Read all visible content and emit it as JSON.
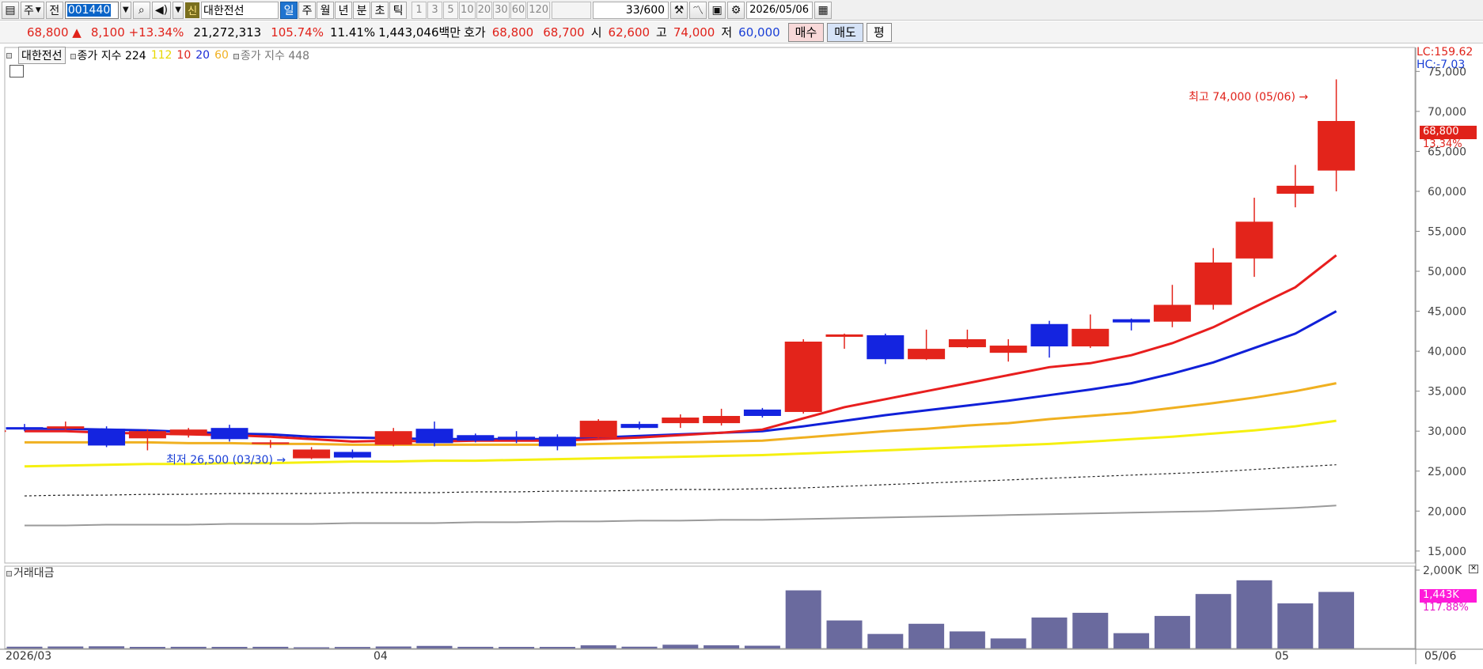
{
  "toolbar": {
    "period_label": "주",
    "prev_label": "전",
    "code": "001440",
    "xin_badge": "신",
    "stock_name": "대한전선",
    "periods": [
      "일",
      "주",
      "월",
      "년",
      "분",
      "초",
      "틱"
    ],
    "active_period": "일",
    "intervals": [
      "1",
      "3",
      "5",
      "10",
      "20",
      "30",
      "60",
      "120"
    ],
    "count": "33/600",
    "date": "2026/05/06"
  },
  "quote": {
    "price": "68,800",
    "direction": "▲",
    "change": "8,100",
    "change_pct": "+13.34%",
    "volume": "21,272,313",
    "volume_ratio": "105.74%",
    "turnover": "11.41%",
    "amount": "1,443,046백만",
    "bid_label": "호가",
    "ask": "68,800",
    "bid": "68,700",
    "open_label": "시",
    "open": "62,600",
    "high_label": "고",
    "high": "74,000",
    "low_label": "저",
    "low": "60,000",
    "buy_label": "매수",
    "sell_label": "매도",
    "flat_label": "평"
  },
  "legend": {
    "stock": "대한전선",
    "index_label": "종가 지수 224",
    "ma_112": "112",
    "ma_10": "10",
    "ma_20": "20",
    "ma_60": "60",
    "index2_label": "종가 지수 448",
    "volume_label": "거래대금"
  },
  "axis_info": {
    "lc": "LC:159.62",
    "hc": "HC:-7.03",
    "price_tag": "68,800",
    "pct_tag": "13.34%",
    "vol_tag": "1,443K",
    "vol_pct_tag": "117.88%"
  },
  "annotations": {
    "high": "최고 74,000 (05/06)",
    "low": "최저 26,500 (03/30)"
  },
  "date_labels": {
    "start": "2026/03",
    "apr": "04",
    "may": "05",
    "end": "05/06"
  },
  "colors": {
    "up": "#e3241b",
    "down": "#1424e0",
    "ma10": "#e81e1e",
    "ma20": "#1020d8",
    "ma60": "#f0b020",
    "ma112": "#f5f010",
    "volume": "#6a6a9e"
  },
  "chart_data": {
    "type": "candlestick",
    "price_axis": {
      "ticks": [
        "15,000",
        "20,000",
        "25,000",
        "30,000",
        "35,000",
        "40,000",
        "45,000",
        "50,000",
        "55,000",
        "60,000",
        "65,000",
        "70,000",
        "75,000"
      ],
      "range": [
        13500,
        78000
      ]
    },
    "volume_axis": {
      "ticks": [
        "2,000K"
      ],
      "range": [
        0,
        2100
      ]
    },
    "candles": [
      {
        "o": 30500,
        "c": 30200,
        "h": 30900,
        "l": 30000
      },
      {
        "o": 30300,
        "c": 30600,
        "h": 31200,
        "l": 30100
      },
      {
        "o": 30300,
        "c": 28200,
        "h": 30600,
        "l": 28000
      },
      {
        "o": 29100,
        "c": 30000,
        "h": 30200,
        "l": 27600
      },
      {
        "o": 29500,
        "c": 30200,
        "h": 30400,
        "l": 29200
      },
      {
        "o": 30400,
        "c": 29000,
        "h": 30800,
        "l": 28700
      },
      {
        "o": 28400,
        "c": 28600,
        "h": 28900,
        "l": 27900
      },
      {
        "o": 26600,
        "c": 27700,
        "h": 28000,
        "l": 26500
      },
      {
        "o": 27400,
        "c": 26700,
        "h": 27700,
        "l": 26600
      },
      {
        "o": 28300,
        "c": 30000,
        "h": 30400,
        "l": 28100
      },
      {
        "o": 30300,
        "c": 28500,
        "h": 31200,
        "l": 28100
      },
      {
        "o": 29500,
        "c": 28800,
        "h": 29700,
        "l": 28600
      },
      {
        "o": 29300,
        "c": 28900,
        "h": 30000,
        "l": 28500
      },
      {
        "o": 29300,
        "c": 28100,
        "h": 29600,
        "l": 27600
      },
      {
        "o": 29200,
        "c": 31300,
        "h": 31500,
        "l": 29000
      },
      {
        "o": 30900,
        "c": 30400,
        "h": 31200,
        "l": 30200
      },
      {
        "o": 31000,
        "c": 31700,
        "h": 32100,
        "l": 30400
      },
      {
        "o": 31000,
        "c": 31900,
        "h": 32800,
        "l": 30700
      },
      {
        "o": 32700,
        "c": 31900,
        "h": 32900,
        "l": 31700
      },
      {
        "o": 32400,
        "c": 41200,
        "h": 41500,
        "l": 32200
      },
      {
        "o": 41800,
        "c": 42100,
        "h": 42200,
        "l": 40300
      },
      {
        "o": 42000,
        "c": 39000,
        "h": 42200,
        "l": 38400
      },
      {
        "o": 39000,
        "c": 40300,
        "h": 42700,
        "l": 38900
      },
      {
        "o": 40500,
        "c": 41500,
        "h": 42700,
        "l": 40400
      },
      {
        "o": 39800,
        "c": 40700,
        "h": 41500,
        "l": 38700
      },
      {
        "o": 43400,
        "c": 40600,
        "h": 43800,
        "l": 39200
      },
      {
        "o": 40600,
        "c": 42800,
        "h": 44600,
        "l": 40400
      },
      {
        "o": 44000,
        "c": 43600,
        "h": 44100,
        "l": 42600
      },
      {
        "o": 43700,
        "c": 45800,
        "h": 48300,
        "l": 43000
      },
      {
        "o": 45800,
        "c": 51100,
        "h": 52900,
        "l": 45200
      },
      {
        "o": 51600,
        "c": 56200,
        "h": 59200,
        "l": 49300
      },
      {
        "o": 59700,
        "c": 60700,
        "h": 63300,
        "l": 58000
      },
      {
        "o": 62600,
        "c": 68800,
        "h": 74000,
        "l": 60000
      }
    ],
    "ma10": [
      30000,
      30000,
      29800,
      29700,
      29600,
      29500,
      29300,
      29000,
      28700,
      28800,
      28700,
      28800,
      28800,
      28800,
      29000,
      29200,
      29500,
      29800,
      30200,
      31600,
      33000,
      34000,
      35000,
      36000,
      37000,
      38000,
      38500,
      39500,
      41000,
      43000,
      45500,
      48000,
      52000
    ],
    "ma20": [
      30300,
      30300,
      30200,
      30100,
      29900,
      29700,
      29600,
      29300,
      29200,
      29100,
      29000,
      29000,
      29000,
      29000,
      29200,
      29400,
      29600,
      29800,
      30000,
      30600,
      31300,
      32000,
      32600,
      33200,
      33800,
      34500,
      35200,
      36000,
      37200,
      38600,
      40400,
      42200,
      45000
    ],
    "ma60": [
      28600,
      28600,
      28600,
      28600,
      28500,
      28500,
      28400,
      28400,
      28300,
      28300,
      28300,
      28300,
      28300,
      28300,
      28400,
      28500,
      28600,
      28700,
      28800,
      29200,
      29600,
      30000,
      30300,
      30700,
      31000,
      31500,
      31900,
      32300,
      32900,
      33500,
      34200,
      35000,
      36000
    ],
    "ma112": [
      25600,
      25700,
      25800,
      25900,
      25900,
      26000,
      26000,
      26100,
      26200,
      26200,
      26300,
      26300,
      26400,
      26500,
      26600,
      26700,
      26800,
      26900,
      27000,
      27200,
      27400,
      27600,
      27800,
      28000,
      28200,
      28400,
      28700,
      29000,
      29300,
      29700,
      30100,
      30600,
      31300
    ],
    "index224": [
      21900,
      22000,
      22000,
      22100,
      22100,
      22200,
      22200,
      22200,
      22300,
      22300,
      22300,
      22400,
      22400,
      22500,
      22500,
      22600,
      22700,
      22700,
      22800,
      22900,
      23100,
      23300,
      23500,
      23700,
      23900,
      24100,
      24300,
      24500,
      24700,
      24900,
      25200,
      25500,
      25800
    ],
    "index448": [
      18200,
      18200,
      18300,
      18300,
      18300,
      18400,
      18400,
      18400,
      18500,
      18500,
      18500,
      18600,
      18600,
      18700,
      18700,
      18800,
      18800,
      18900,
      18900,
      19000,
      19100,
      19200,
      19300,
      19400,
      19500,
      19600,
      19700,
      19800,
      19900,
      20000,
      20200,
      20400,
      20700
    ],
    "volume": [
      45,
      50,
      55,
      40,
      42,
      40,
      42,
      30,
      38,
      50,
      65,
      42,
      40,
      40,
      80,
      45,
      95,
      80,
      70,
      1483,
      715,
      370,
      630,
      435,
      255,
      790,
      910,
      390,
      830,
      1390,
      1740,
      1150,
      1443
    ]
  }
}
